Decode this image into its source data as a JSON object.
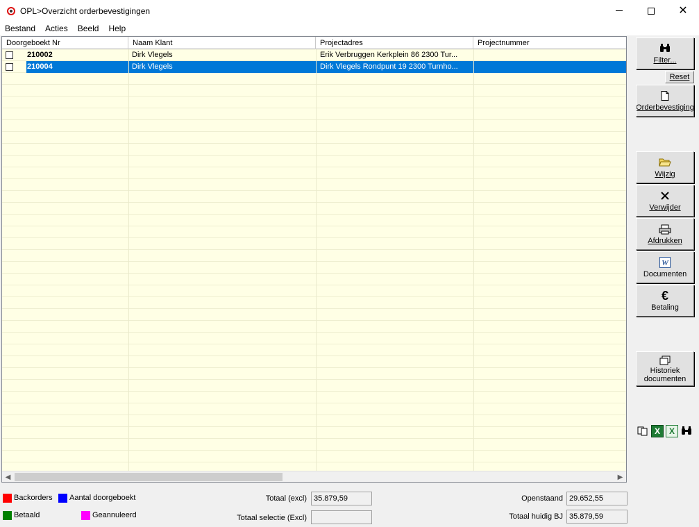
{
  "window": {
    "title": "OPL>Overzicht orderbevestigingen",
    "controls": {
      "minimize": "minimize",
      "maximize": "maximize",
      "close": "✕"
    }
  },
  "menu": [
    {
      "label": "Bestand"
    },
    {
      "label": "Acties"
    },
    {
      "label": "Beeld"
    },
    {
      "label": "Help"
    }
  ],
  "grid": {
    "columns": [
      "Doorgeboekt  Nr",
      "Naam Klant",
      "Projectadres",
      "Projectnummer"
    ],
    "rows": [
      {
        "nr": "210002",
        "klant": "Dirk Vlegels",
        "adres": "Erik Verbruggen Kerkplein 86 2300 Tur...",
        "projectnummer": "",
        "selected": false
      },
      {
        "nr": "210004",
        "klant": "Dirk Vlegels",
        "adres": "Dirk Vlegels Rondpunt 19 2300 Turnho...",
        "projectnummer": "",
        "selected": true
      }
    ]
  },
  "sidebar": {
    "filter": "Filter...",
    "reset": "Reset",
    "orderbevestiging": "Orderbevestiging",
    "wijzig": "Wijzig",
    "verwijder": "Verwijder",
    "afdrukken": "Afdrukken",
    "documenten": "Documenten",
    "betaling": "Betaling",
    "betaling_symbol": "€",
    "historiek_line1": "Historiek",
    "historiek_line2": "documenten",
    "word_letter": "W",
    "excel_letter": "X"
  },
  "legend": [
    {
      "label": "Backorders",
      "color": "#ff0000"
    },
    {
      "label": "Aantal doorgeboekt",
      "color": "#0000ff"
    },
    {
      "label": "Betaald",
      "color": "#008000"
    },
    {
      "label": "Geannuleerd",
      "color": "#ff00ff"
    }
  ],
  "totals": {
    "totaal_excl_label": "Totaal (excl)",
    "totaal_excl_value": "35.879,59",
    "totaal_selectie_label": "Totaal selectie (Excl)",
    "totaal_selectie_value": "",
    "openstaand_label": "Openstaand",
    "openstaand_value": "29.652,55",
    "totaal_bj_label": "Totaal huidig BJ",
    "totaal_bj_value": "35.879,59"
  },
  "colors": {
    "grid_background": "#ffffe5",
    "selection": "#0078d7"
  }
}
